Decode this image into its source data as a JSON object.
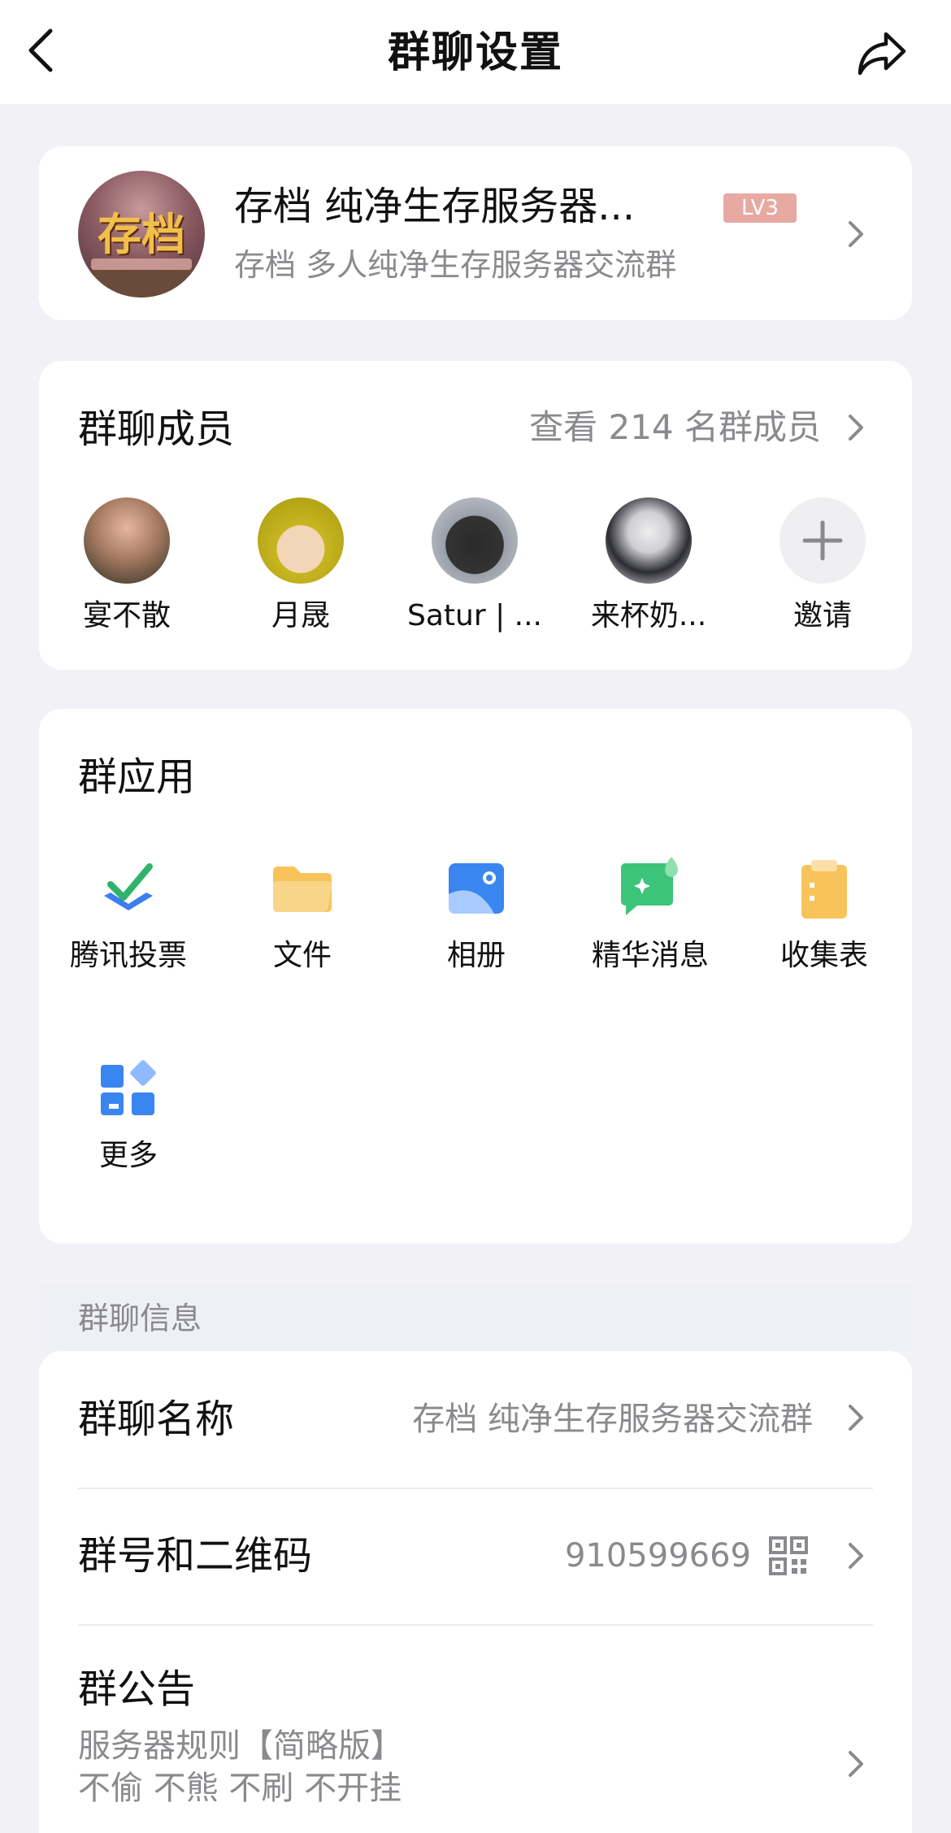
{
  "header": {
    "title": "群聊设置",
    "back_icon": "chevron-left-icon",
    "share_icon": "share-icon"
  },
  "group": {
    "avatar_text": "存档",
    "name": "存档 纯净生存服务器...",
    "level_badge": "LV3",
    "description": "存档 多人纯净生存服务器交流群"
  },
  "members": {
    "title": "群聊成员",
    "view_all_label": "查看 214 名群成员",
    "list": [
      {
        "name": "宴不散"
      },
      {
        "name": "月晟"
      },
      {
        "name": "Satur | ..."
      },
      {
        "name": "来杯奶..."
      }
    ],
    "invite_label": "邀请"
  },
  "apps": {
    "title": "群应用",
    "items": [
      {
        "label": "腾讯投票",
        "icon": "vote-icon",
        "color": "#3a7ef0"
      },
      {
        "label": "文件",
        "icon": "folder-icon",
        "color": "#f5b94a"
      },
      {
        "label": "相册",
        "icon": "album-icon",
        "color": "#3a86f0"
      },
      {
        "label": "精华消息",
        "icon": "essence-message-icon",
        "color": "#3cc47a"
      },
      {
        "label": "收集表",
        "icon": "clipboard-icon",
        "color": "#f5b94a"
      },
      {
        "label": "更多",
        "icon": "more-apps-icon",
        "color": "#3a86f0"
      }
    ]
  },
  "info": {
    "section_label": "群聊信息",
    "group_name_label": "群聊名称",
    "group_name_value": "存档 纯净生存服务器交流群",
    "group_number_label": "群号和二维码",
    "group_number_value": "910599669",
    "notice_label": "群公告",
    "notice_line1": "服务器规则【简略版】",
    "notice_line2": "不偷 不熊 不刷 不开挂"
  }
}
